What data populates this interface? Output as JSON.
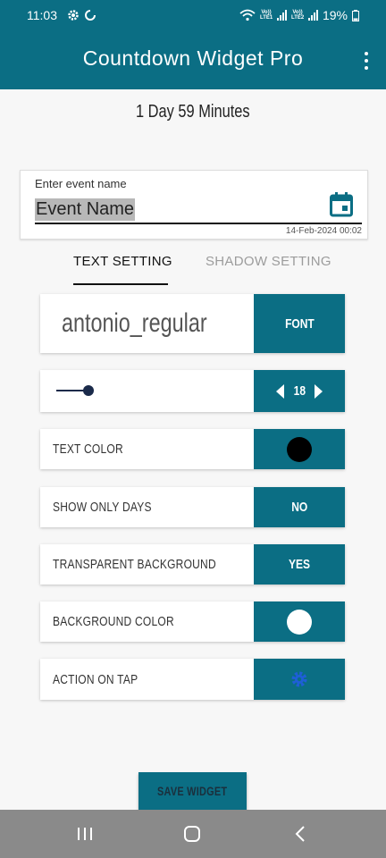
{
  "status": {
    "time": "11:03",
    "battery": "19%",
    "sim1": "Vo)) LTE1",
    "sim2": "Vo)) LTE2"
  },
  "app": {
    "title": "Countdown Widget Pro"
  },
  "countdown": "1 Day 59 Minutes",
  "event": {
    "label": "Enter event name",
    "value": "Event Name",
    "date": "14-Feb-2024 00:02"
  },
  "tabs": [
    {
      "label": "TEXT SETTING",
      "active": true
    },
    {
      "label": "SHADOW SETTING",
      "active": false
    }
  ],
  "settings": {
    "font": {
      "name": "antonio_regular",
      "button": "FONT"
    },
    "size": {
      "value": "18",
      "slider_level": 0.15
    },
    "text_color": {
      "label": "TEXT COLOR",
      "color": "#000000"
    },
    "show_only_days": {
      "label": "SHOW ONLY DAYS",
      "value": "NO"
    },
    "transparent_background": {
      "label": "TRANSPARENT BACKGROUND",
      "value": "YES"
    },
    "background_color": {
      "label": "BACKGROUND COLOR",
      "color": "#ffffff"
    },
    "action_on_tap": {
      "label": "ACTION ON TAP",
      "icon": "gear-icon"
    }
  },
  "save_button": "SAVE WIDGET",
  "colors": {
    "accent": "#0b6e84",
    "gear": "#1f5fd6"
  }
}
